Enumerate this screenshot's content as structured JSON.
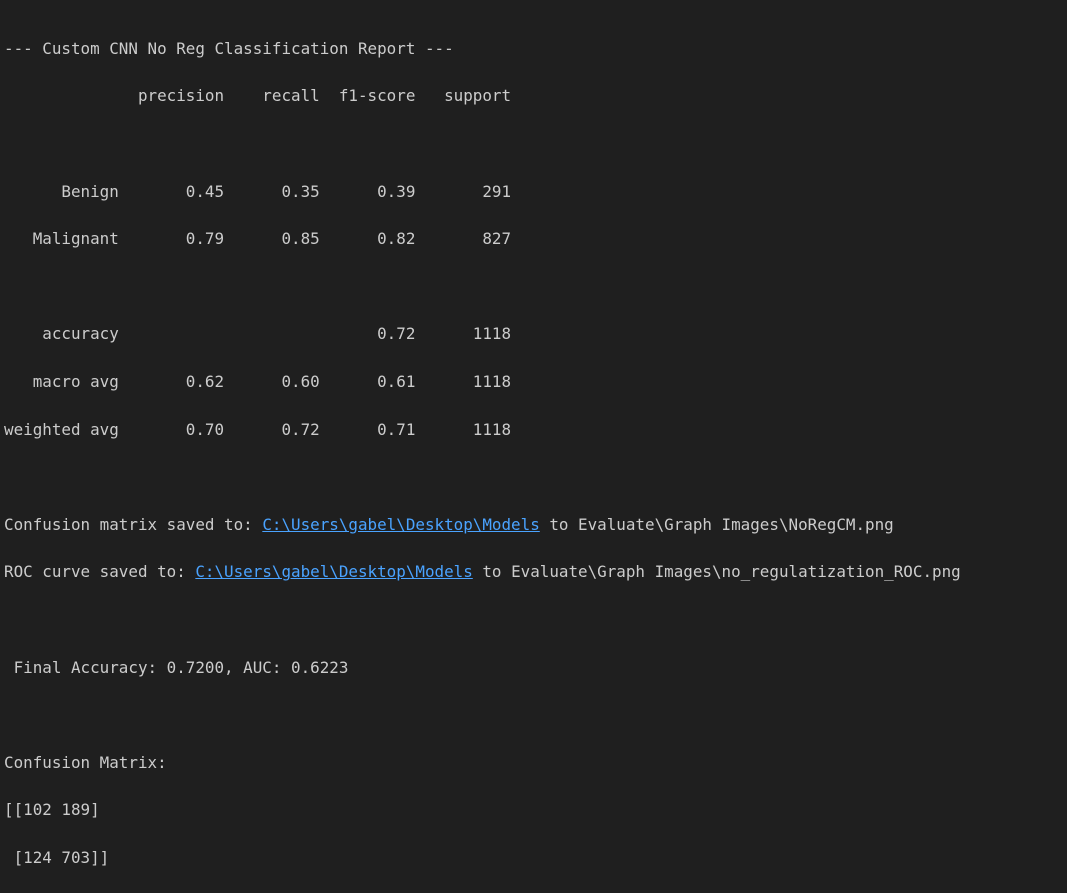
{
  "report": {
    "header": "--- Custom CNN No Reg Classification Report ---",
    "columns_line": "              precision    recall  f1-score   support",
    "rows": [
      "      Benign       0.45      0.35      0.39       291",
      "   Malignant       0.79      0.85      0.82       827",
      "    accuracy                           0.72      1118",
      "   macro avg       0.62      0.60      0.61      1118",
      "weighted avg       0.70      0.72      0.71      1118"
    ]
  },
  "saves": {
    "confusion_prefix": "Confusion matrix saved to: ",
    "confusion_link": "C:\\Users\\gabel\\Desktop\\Models",
    "confusion_suffix": " to Evaluate\\Graph Images\\NoRegCM.png",
    "roc_prefix": "ROC curve saved to: ",
    "roc_link": "C:\\Users\\gabel\\Desktop\\Models",
    "roc_suffix": " to Evaluate\\Graph Images\\no_regulatization_ROC.png"
  },
  "final": " Final Accuracy: 0.7200, AUC: 0.6223",
  "matrix": {
    "title": "Confusion Matrix:",
    "row1": "[[102 189]",
    "row2": " [124 703]]"
  },
  "colors": {
    "background": "#1f1f1f",
    "text": "#cccccc",
    "link": "#4aa3ff"
  }
}
